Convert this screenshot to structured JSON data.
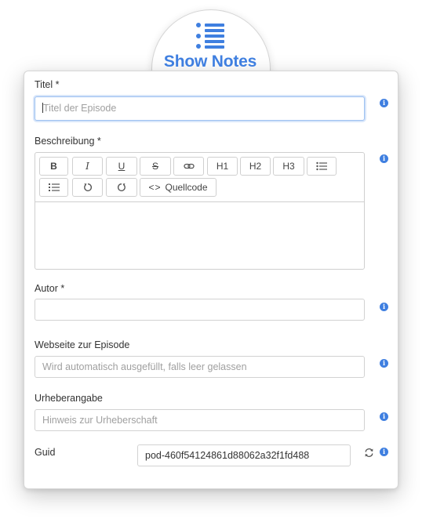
{
  "header": {
    "title": "Show Notes",
    "icon": "list-icon"
  },
  "fields": {
    "title": {
      "label": "Titel *",
      "placeholder": "Titel der Episode",
      "value": ""
    },
    "description": {
      "label": "Beschreibung *",
      "toolbar": {
        "bold": "B",
        "italic": "I",
        "underline": "U",
        "strike": "S",
        "h1": "H1",
        "h2": "H2",
        "h3": "H3",
        "source": "Quellcode",
        "source_glyph": "<>"
      },
      "value": ""
    },
    "author": {
      "label": "Autor *",
      "value": "",
      "placeholder": ""
    },
    "website": {
      "label": "Webseite zur Episode",
      "placeholder": "Wird automatisch ausgefüllt, falls leer gelassen",
      "value": ""
    },
    "credits": {
      "label": "Urheberangabe",
      "placeholder": "Hinweis zur Urheberschaft",
      "value": ""
    },
    "guid": {
      "label": "Guid",
      "value": "pod-460f54124861d88062a32f1fd488"
    }
  },
  "info_glyph": "i",
  "colors": {
    "accent": "#3f7fe0",
    "border": "#d2d2d2",
    "focus": "#9cc0f0"
  }
}
